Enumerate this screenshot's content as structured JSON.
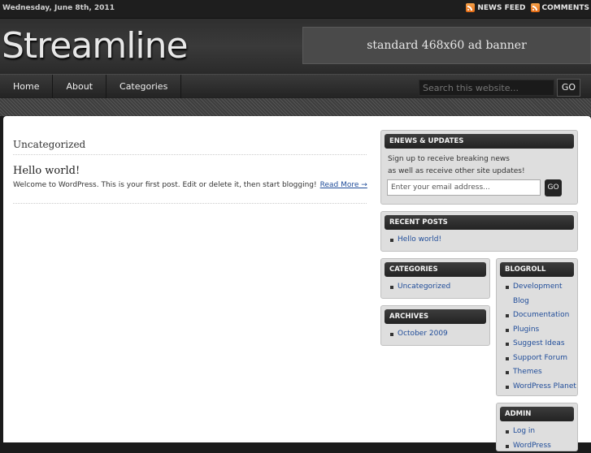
{
  "topbar": {
    "date": "Wednesday, June 8th, 2011",
    "news_feed": "NEWS FEED",
    "comments": "COMMENTS"
  },
  "header": {
    "logo": "Streamline",
    "ad": "standard 468x60 ad banner"
  },
  "nav": {
    "items": [
      "Home",
      "About",
      "Categories"
    ],
    "search_placeholder": "Search this website...",
    "go": "GO"
  },
  "main": {
    "category_title": "Uncategorized",
    "post_title": "Hello world!",
    "post_excerpt": "Welcome to WordPress. This is your first post. Edit or delete it, then start blogging!",
    "read_more": "Read More →"
  },
  "sidebar": {
    "enews": {
      "title": "ENEWS & UPDATES",
      "line1": "Sign up to receive breaking news",
      "line2": "as well as receive other site updates!",
      "placeholder": "Enter your email address...",
      "go": "GO"
    },
    "recent": {
      "title": "RECENT POSTS",
      "items": [
        "Hello world!"
      ]
    },
    "categories": {
      "title": "CATEGORIES",
      "items": [
        "Uncategorized"
      ]
    },
    "archives": {
      "title": "ARCHIVES",
      "items": [
        "October 2009"
      ]
    },
    "blogroll": {
      "title": "BLOGROLL",
      "items": [
        "Development Blog",
        "Documentation",
        "Plugins",
        "Suggest Ideas",
        "Support Forum",
        "Themes",
        "WordPress Planet"
      ]
    },
    "admin": {
      "title": "ADMIN",
      "items": [
        "Log in",
        "WordPress"
      ]
    }
  }
}
